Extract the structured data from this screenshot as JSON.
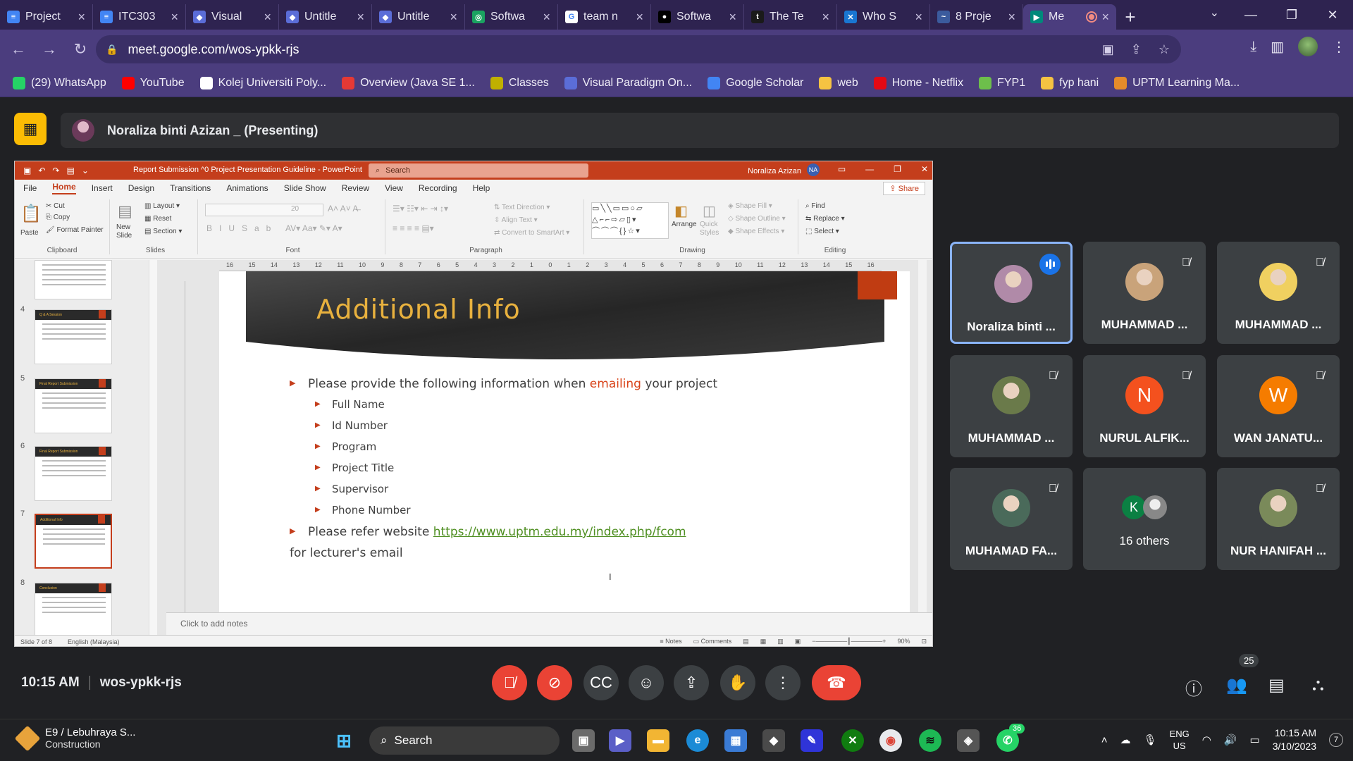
{
  "browser": {
    "tabs": [
      {
        "title": "Project",
        "color": "#4285f4",
        "glyph": "≡"
      },
      {
        "title": "ITC303",
        "color": "#4285f4",
        "glyph": "≡"
      },
      {
        "title": "Visual",
        "color": "#5b6dd8",
        "glyph": "◆"
      },
      {
        "title": "Untitle",
        "color": "#5b6dd8",
        "glyph": "◆"
      },
      {
        "title": "Untitle",
        "color": "#5b6dd8",
        "glyph": "◆"
      },
      {
        "title": "Softwa",
        "color": "#1aa260",
        "glyph": "◎"
      },
      {
        "title": "team n",
        "color": "#ffffff",
        "glyph": "G"
      },
      {
        "title": "Softwa",
        "color": "#000000",
        "glyph": "●"
      },
      {
        "title": "The Te",
        "color": "#1a1a1a",
        "glyph": "t"
      },
      {
        "title": "Who S",
        "color": "#1976d2",
        "glyph": "✕"
      },
      {
        "title": "8 Proje",
        "color": "#3b5b9d",
        "glyph": "~"
      },
      {
        "title": "Me",
        "color": "#00897b",
        "glyph": "▶"
      }
    ],
    "url": "meet.google.com/wos-ypkk-rjs",
    "bookmarks": [
      {
        "label": "(29) WhatsApp",
        "color": "#25d366"
      },
      {
        "label": "YouTube",
        "color": "#ff0000"
      },
      {
        "label": "Kolej Universiti Poly...",
        "color": "#ffffff"
      },
      {
        "label": "Overview (Java SE 1...",
        "color": "#e53935"
      },
      {
        "label": "Classes",
        "color": "#c0b000"
      },
      {
        "label": "Visual Paradigm On...",
        "color": "#5b6dd8"
      },
      {
        "label": "Google Scholar",
        "color": "#4285f4"
      },
      {
        "label": "web",
        "color": "#f6c342"
      },
      {
        "label": "Home - Netflix",
        "color": "#e50914"
      },
      {
        "label": "FYP1",
        "color": "#6dbf4b"
      },
      {
        "label": "fyp hani",
        "color": "#f6c342"
      },
      {
        "label": "UPTM Learning Ma...",
        "color": "#e58b2a"
      }
    ]
  },
  "meet": {
    "presenter": "Noraliza binti Azizan _ (Presenting)",
    "time": "10:15 AM",
    "meeting_code": "wos-ypkk-rjs",
    "participant_count": "25",
    "tiles": [
      {
        "name": "Noraliza binti ...",
        "speaking": true,
        "avatar": "photo",
        "color": "#b08aa8"
      },
      {
        "name": "MUHAMMAD ...",
        "muted": true,
        "avatar": "photo",
        "color": "#c9a37a"
      },
      {
        "name": "MUHAMMAD ...",
        "muted": true,
        "avatar": "photo",
        "color": "#f0d060"
      },
      {
        "name": "MUHAMMAD ...",
        "muted": true,
        "avatar": "photo",
        "color": "#6a7a4a"
      },
      {
        "name": "NURUL ALFIK...",
        "muted": true,
        "avatar": "N",
        "color": "#f4511e"
      },
      {
        "name": "WAN JANATU...",
        "muted": true,
        "avatar": "W",
        "color": "#f57c00"
      },
      {
        "name": "MUHAMAD FA...",
        "muted": true,
        "avatar": "photo",
        "color": "#4a6a5a"
      },
      {
        "name": "16 others",
        "muted": false,
        "avatar": "K",
        "color": "#0b8043"
      },
      {
        "name": "NUR HANIFAH ...",
        "muted": true,
        "avatar": "photo",
        "color": "#7a8a5a"
      }
    ]
  },
  "ppt": {
    "window_title": "Report Submission ^0 Project Presentation Guideline  -  PowerPoint",
    "search_placeholder": "Search",
    "user": "Noraliza Azizan",
    "user_initials": "NA",
    "menu": [
      "File",
      "Home",
      "Insert",
      "Design",
      "Transitions",
      "Animations",
      "Slide Show",
      "Review",
      "View",
      "Recording",
      "Help"
    ],
    "share": "Share",
    "ribbon": {
      "clipboard": "Clipboard",
      "paste": "Paste",
      "cut": "Cut",
      "copy": "Copy",
      "format_painter": "Format Painter",
      "slides": "Slides",
      "new_slide": "New Slide",
      "layout": "Layout",
      "reset": "Reset",
      "section": "Section",
      "font": "Font",
      "font_size": "20",
      "paragraph": "Paragraph",
      "text_direction": "Text Direction",
      "align_text": "Align Text",
      "convert": "Convert to SmartArt",
      "drawing": "Drawing",
      "arrange": "Arrange",
      "quick_styles": "Quick Styles",
      "shape_fill": "Shape Fill",
      "shape_outline": "Shape Outline",
      "shape_effects": "Shape Effects",
      "editing": "Editing",
      "find": "Find",
      "replace": "Replace",
      "select": "Select"
    },
    "thumb_numbers": [
      "4",
      "5",
      "6",
      "7",
      "8"
    ],
    "thumb_titles": [
      "Q & A Session",
      "Final Report Submission",
      "Final Report Submission",
      "Additional Info",
      "Conclusion"
    ],
    "ruler": [
      "16",
      "15",
      "14",
      "13",
      "12",
      "11",
      "10",
      "9",
      "8",
      "7",
      "6",
      "5",
      "4",
      "3",
      "2",
      "1",
      "0",
      "1",
      "2",
      "3",
      "4",
      "5",
      "6",
      "7",
      "8",
      "9",
      "10",
      "11",
      "12",
      "13",
      "14",
      "15",
      "16"
    ],
    "slide": {
      "title": "Additional Info",
      "intro_before": "Please provide the following information when ",
      "intro_emph": "emailing",
      "intro_after": " your project",
      "items": [
        "Full Name",
        "Id Number",
        "Program",
        "Project Title",
        "Supervisor",
        "Phone Number"
      ],
      "refer_text": "Please refer website ",
      "refer_link": "https://www.uptm.edu.my/index.php/fcom",
      "lecturer": "for lecturer's email"
    },
    "notes_placeholder": "Click to add notes",
    "status": {
      "slide": "Slide 7 of 8",
      "language": "English (Malaysia)",
      "notes": "Notes",
      "comments": "Comments",
      "zoom": "90%"
    }
  },
  "taskbar": {
    "weather_title": "E9 / Lebuhraya S...",
    "weather_sub": "Construction",
    "search": "Search",
    "whatsapp_badge": "36",
    "lang_top": "ENG",
    "lang_bottom": "US",
    "clock_time": "10:15 AM",
    "clock_date": "3/10/2023",
    "notif": "7"
  }
}
